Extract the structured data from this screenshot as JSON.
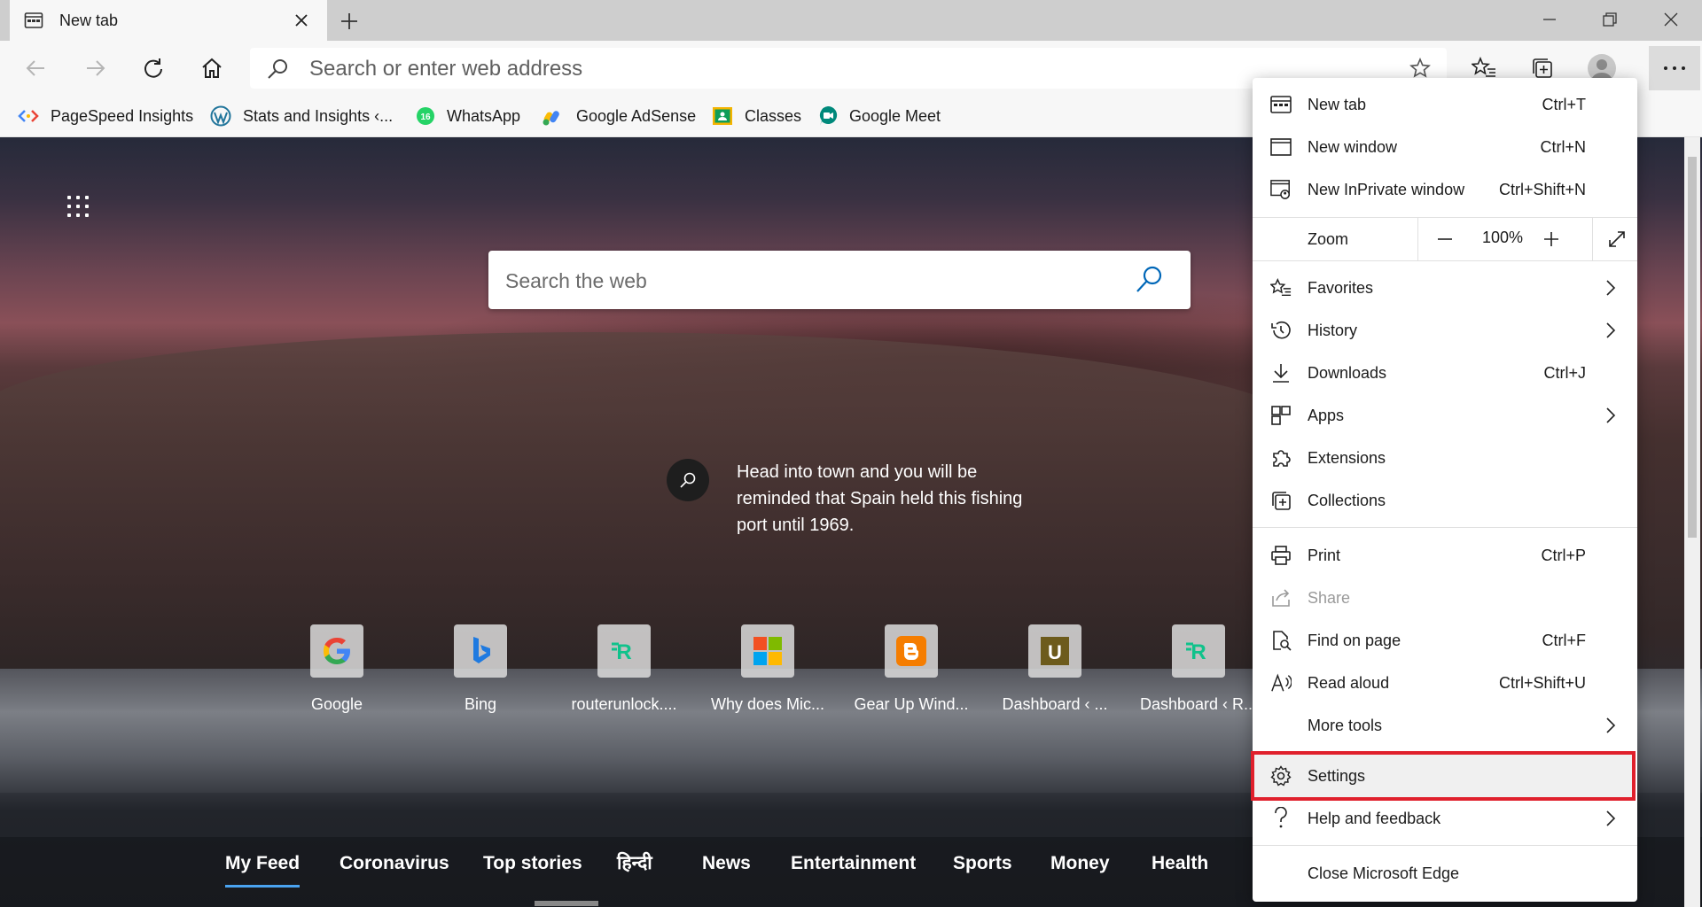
{
  "tab": {
    "title": "New tab"
  },
  "toolbar": {
    "address_placeholder": "Search or enter web address"
  },
  "bookmarks": [
    {
      "label": "PageSpeed Insights"
    },
    {
      "label": "Stats and Insights ‹..."
    },
    {
      "label": "WhatsApp",
      "badge": "16"
    },
    {
      "label": "Google AdSense"
    },
    {
      "label": "Classes"
    },
    {
      "label": "Google Meet"
    }
  ],
  "page": {
    "search_placeholder": "Search the web",
    "fact": "Head into town and you will be reminded that Spain held this fishing port until 1969.",
    "tiles": [
      {
        "label": "Google",
        "icon": "google-icon"
      },
      {
        "label": "Bing",
        "icon": "bing-icon"
      },
      {
        "label": "routerunlock....",
        "icon": "routerunlock-icon"
      },
      {
        "label": "Why does Mic...",
        "icon": "microsoft-icon"
      },
      {
        "label": "Gear Up Wind...",
        "icon": "blogger-icon"
      },
      {
        "label": "Dashboard ‹ ...",
        "icon": "u-icon"
      },
      {
        "label": "Dashboard ‹ R...",
        "icon": "routerunlock-icon"
      }
    ],
    "feed": [
      "My Feed",
      "Coronavirus",
      "Top stories",
      "हिन्दी",
      "News",
      "Entertainment",
      "Sports",
      "Money",
      "Health"
    ]
  },
  "menu": {
    "new_tab": {
      "label": "New tab",
      "key": "Ctrl+T"
    },
    "new_window": {
      "label": "New window",
      "key": "Ctrl+N"
    },
    "new_inprivate": {
      "label": "New InPrivate window",
      "key": "Ctrl+Shift+N"
    },
    "zoom": {
      "label": "Zoom",
      "value": "100%"
    },
    "favorites": {
      "label": "Favorites"
    },
    "history": {
      "label": "History"
    },
    "downloads": {
      "label": "Downloads",
      "key": "Ctrl+J"
    },
    "apps": {
      "label": "Apps"
    },
    "extensions": {
      "label": "Extensions"
    },
    "collections": {
      "label": "Collections"
    },
    "print": {
      "label": "Print",
      "key": "Ctrl+P"
    },
    "share": {
      "label": "Share"
    },
    "find": {
      "label": "Find on page",
      "key": "Ctrl+F"
    },
    "read_aloud": {
      "label": "Read aloud",
      "key": "Ctrl+Shift+U"
    },
    "more_tools": {
      "label": "More tools"
    },
    "settings": {
      "label": "Settings"
    },
    "help": {
      "label": "Help and feedback"
    },
    "close": {
      "label": "Close Microsoft Edge"
    }
  },
  "colors": {
    "highlight": "#e0202c",
    "accent": "#0067b8",
    "feed_underline": "#4aa3f0"
  }
}
